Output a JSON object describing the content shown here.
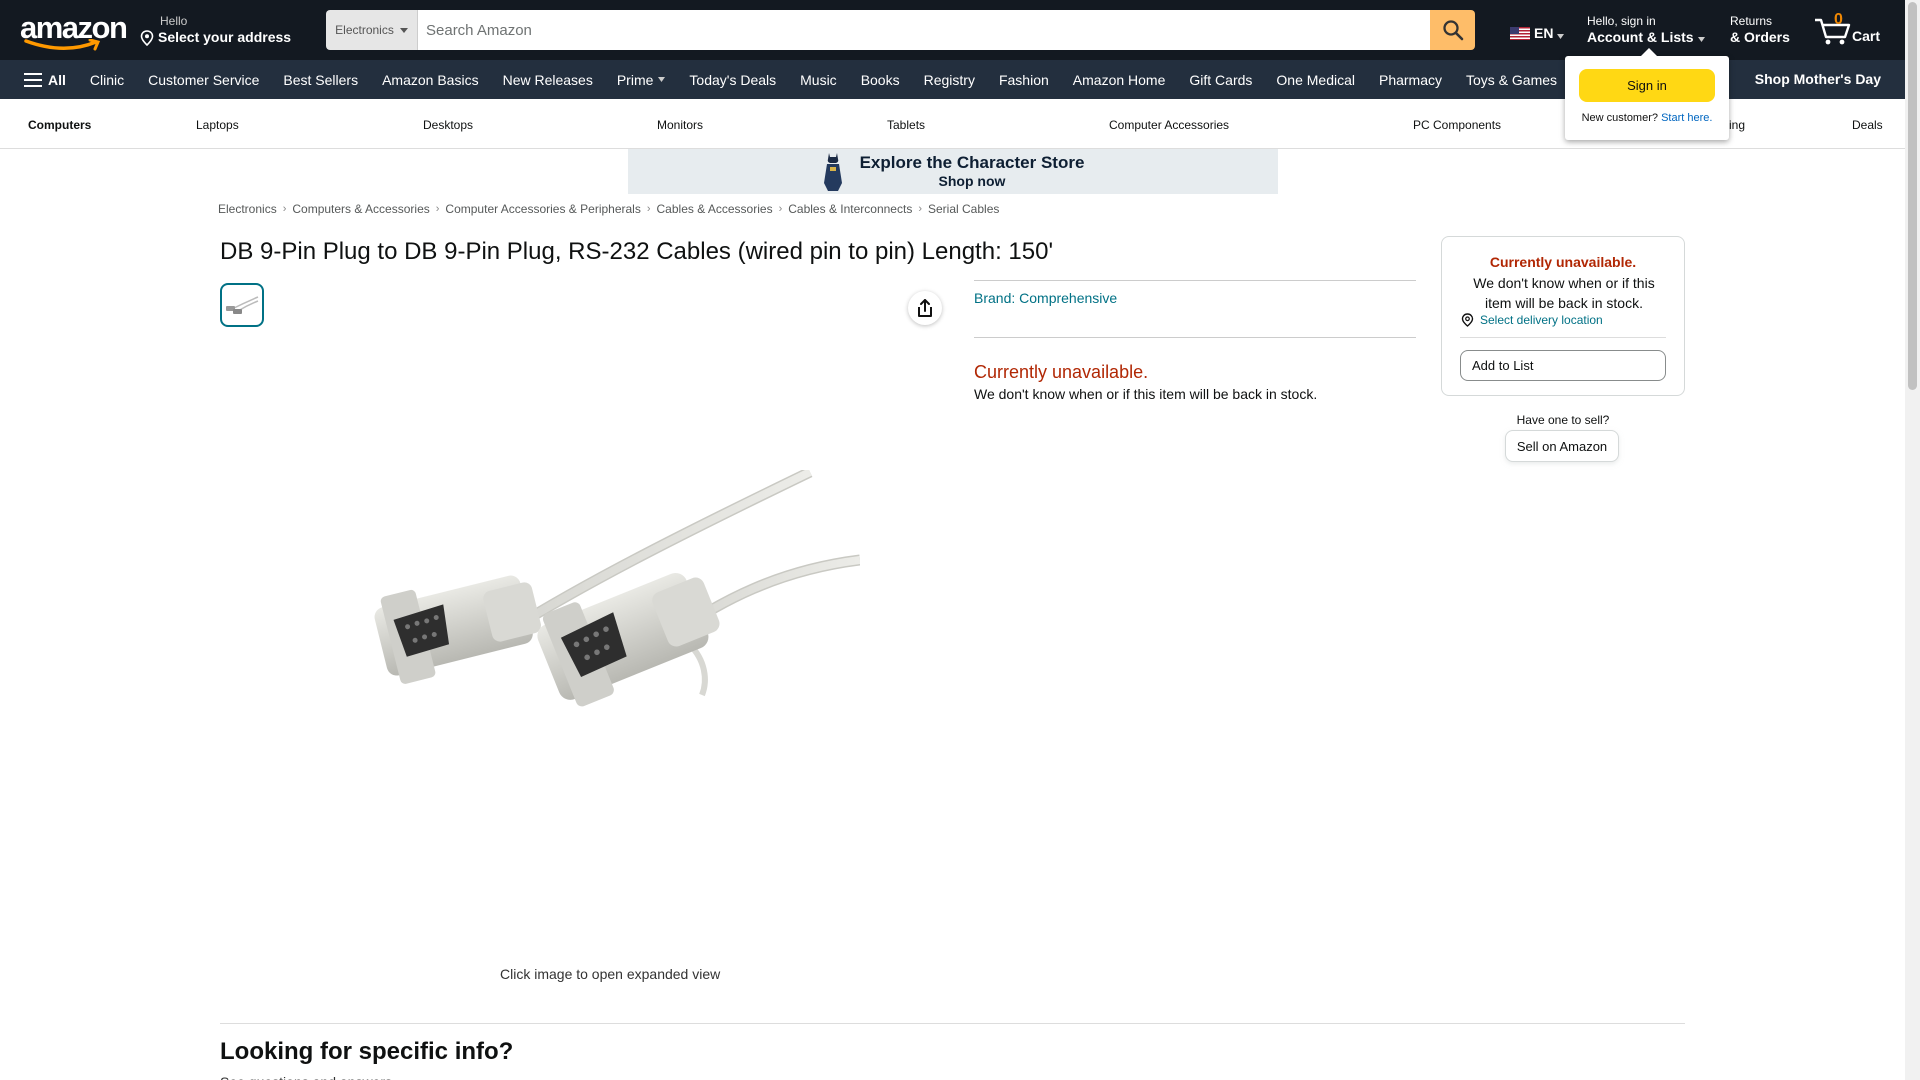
{
  "header": {
    "logo_text": "amazon",
    "deliver_line1": "Hello",
    "deliver_line2": "Select your address",
    "search_category": "Electronics",
    "search_placeholder": "Search Amazon",
    "language": "EN",
    "account_line1": "Hello, sign in",
    "account_line2": "Account & Lists",
    "returns_line1": "Returns",
    "returns_line2": "& Orders",
    "cart_count": "0",
    "cart_label": "Cart"
  },
  "main_nav": {
    "all_label": "All",
    "items": [
      "Clinic",
      "Customer Service",
      "Best Sellers",
      "Amazon Basics",
      "New Releases",
      "Prime",
      "Today's Deals",
      "Music",
      "Books",
      "Registry",
      "Fashion",
      "Amazon Home",
      "Gift Cards",
      "One Medical",
      "Pharmacy",
      "Toys & Games"
    ],
    "right_promo": "Shop Mother's Day"
  },
  "sub_nav": {
    "items": [
      "Computers",
      "Laptops",
      "Desktops",
      "Monitors",
      "Tablets",
      "Computer Accessories",
      "PC Components",
      "ming",
      "Deals"
    ]
  },
  "banner": {
    "line1": "Explore the Character Store",
    "line2": "Shop now"
  },
  "breadcrumb": [
    "Electronics",
    "Computers & Accessories",
    "Computer Accessories & Peripherals",
    "Cables & Accessories",
    "Cables & Interconnects",
    "Serial Cables"
  ],
  "product": {
    "title": "DB 9-Pin Plug to DB 9-Pin Plug, RS-232 Cables (wired pin to pin) Length: 150'",
    "brand": "Brand: Comprehensive",
    "status": "Currently unavailable.",
    "status_detail": "We don't know when or if this item will be back in stock.",
    "expand_note": "Click image to open expanded view"
  },
  "buy_box": {
    "title": "Currently unavailable.",
    "text": "We don't know when or if this item will be back in stock.",
    "location_link": "Select delivery location",
    "add_to_list": "Add to List",
    "sell_question": "Have one to sell?",
    "sell_button": "Sell on Amazon"
  },
  "sign_in_flyout": {
    "button": "Sign in",
    "new_customer": "New customer?",
    "start_here": "Start here."
  },
  "bottom": {
    "heading": "Looking for specific info?",
    "subtext": "See questions and answers"
  },
  "colors": {
    "header_bg": "#131921",
    "nav_bg": "#232f3e",
    "search_button": "#febd69",
    "unavailable": "#b12704",
    "link": "#007185",
    "sign_in_button": "#ffd814"
  }
}
